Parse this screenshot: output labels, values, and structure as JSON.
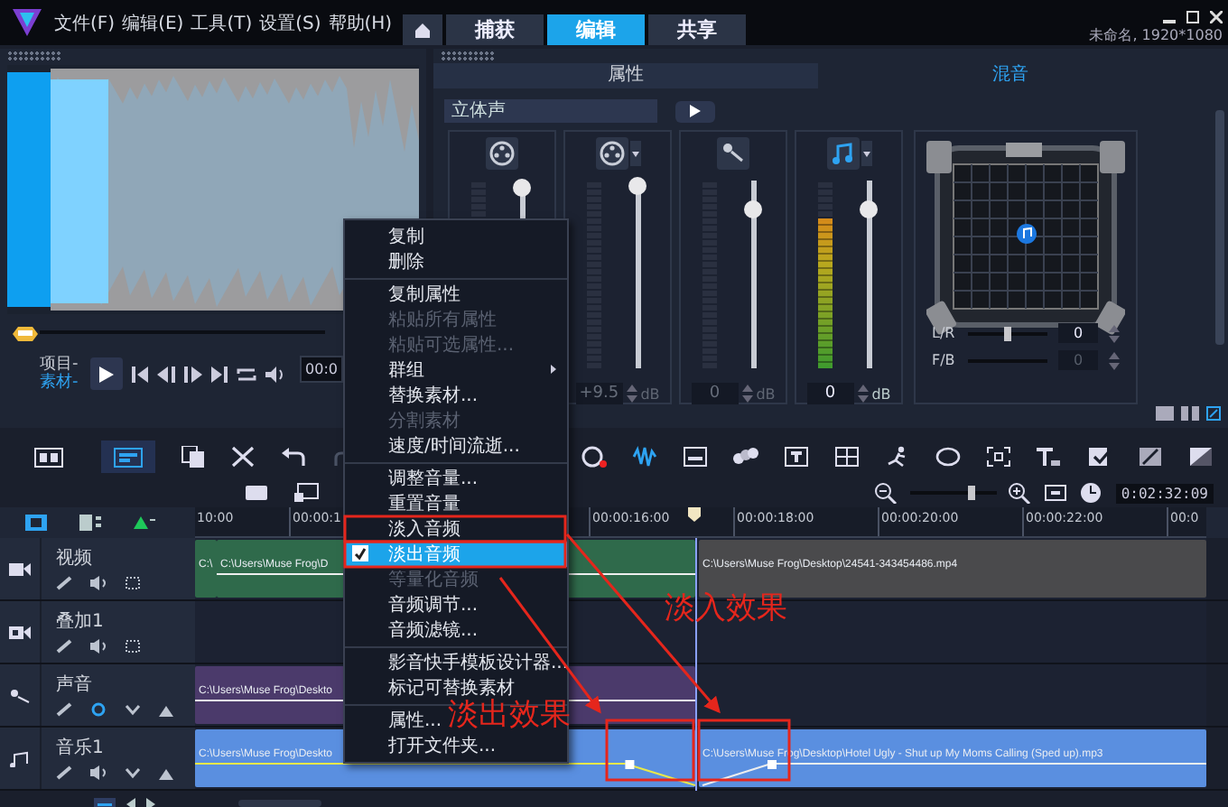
{
  "title_bar": {
    "menus": [
      "文件(F)",
      "编辑(E)",
      "工具(T)",
      "设置(S)",
      "帮助(H)"
    ],
    "tabs": [
      {
        "label": "捕获",
        "selected": false
      },
      {
        "label": "编辑",
        "selected": true
      },
      {
        "label": "共享",
        "selected": false
      }
    ],
    "project": "未命名, 1920*1080"
  },
  "preview": {
    "modes": [
      {
        "label": "项目-",
        "selected": false
      },
      {
        "label": "素材-",
        "selected": true
      }
    ],
    "timecode": "00:0"
  },
  "options": {
    "tabs": [
      {
        "label": "属性",
        "selected": false
      },
      {
        "label": "混音",
        "selected": true
      }
    ],
    "channel_mode": "立体声",
    "channels": [
      {
        "kind": "film",
        "has_menu": false,
        "slider": {
          "level": 0.96
        }
      },
      {
        "kind": "film",
        "has_menu": true,
        "slider": {
          "level": 0.97
        },
        "reading": "+9.5",
        "unit": "dB",
        "disabled": true
      },
      {
        "kind": "microphone",
        "has_menu": false,
        "slider": {
          "level": 0.85
        },
        "reading": "0",
        "unit": "dB",
        "disabled": true
      },
      {
        "kind": "music",
        "has_menu": true,
        "slider": {
          "level": 0.85
        },
        "meter": {
          "level": 0.8
        },
        "reading": "0",
        "unit": "dB",
        "disabled": false
      }
    ],
    "surround": {
      "controls": [
        {
          "label": "L/R",
          "slider": {
            "level": 0.5
          },
          "value": "0",
          "disabled": false
        },
        {
          "label": "F/B",
          "value": "0",
          "disabled": true
        }
      ]
    }
  },
  "timeline": {
    "view_modes": [
      {
        "selected": false
      },
      {
        "selected": true
      }
    ],
    "zoom": {
      "level": 0.72
    },
    "timecode": "0:02:32:09",
    "ruler": [
      "10:00",
      "00:00:1",
      "00:00:16:00",
      "00:00:18:00",
      "00:00:20:00",
      "00:00:22:00",
      "00:0"
    ],
    "tracks": [
      {
        "kind": "video",
        "name": "视频",
        "clips_before": [
          {
            "label": "C:\\",
            "color": "#2f6a4b",
            "volume_line": false
          },
          {
            "label": "C:\\Users\\Muse Frog\\D",
            "color": "#2f6a4b",
            "volume_line": true,
            "fade_in": false,
            "fade_out": false
          }
        ],
        "clips_after": [
          {
            "label": "C:\\Users\\Muse Frog\\Desktop\\24541-343454486.mp4",
            "color": "#4a4a4c",
            "volume_line": false
          }
        ]
      },
      {
        "kind": "overlay",
        "name": "叠加1"
      },
      {
        "kind": "voice",
        "name": "声音",
        "clips_before": [
          {
            "label": "C:\\Users\\Muse Frog\\Deskto",
            "color": "#4b3a6b",
            "volume_line": true,
            "fade_in": false,
            "fade_out": false
          }
        ]
      },
      {
        "kind": "music",
        "name": "音乐1",
        "clips_before": [
          {
            "label": "C:\\Users\\Muse Frog\\Deskto",
            "color": "#5a8fe0",
            "volume_line": true,
            "fade_in": false,
            "fade_out": true
          }
        ],
        "clips_after": [
          {
            "label": "C:\\Users\\Muse Frog\\Desktop\\Hotel Ugly - Shut up My Moms Calling (Sped up).mp3",
            "color": "#5a8fe0",
            "volume_line": true,
            "fade_in": true,
            "fade_out": false
          }
        ]
      }
    ]
  },
  "context_menu": {
    "items": [
      {
        "kind": "item",
        "label": "复制",
        "disabled": false,
        "checked": false,
        "selected": false
      },
      {
        "kind": "item",
        "label": "删除",
        "disabled": false,
        "checked": false,
        "selected": false
      },
      {
        "kind": "separator"
      },
      {
        "kind": "item",
        "label": "复制属性",
        "disabled": false,
        "checked": false,
        "selected": false
      },
      {
        "kind": "item",
        "label": "粘贴所有属性",
        "disabled": true,
        "checked": false,
        "selected": false
      },
      {
        "kind": "item",
        "label": "粘贴可选属性...",
        "disabled": true,
        "checked": false,
        "selected": false
      },
      {
        "kind": "submenu",
        "label": "群组",
        "disabled": false,
        "checked": false,
        "selected": false
      },
      {
        "kind": "item",
        "label": "替换素材...",
        "disabled": false,
        "checked": false,
        "selected": false
      },
      {
        "kind": "item",
        "label": "分割素材",
        "disabled": true,
        "checked": false,
        "selected": false
      },
      {
        "kind": "item",
        "label": "速度/时间流逝...",
        "disabled": false,
        "checked": false,
        "selected": false
      },
      {
        "kind": "separator"
      },
      {
        "kind": "item",
        "label": "调整音量...",
        "disabled": false,
        "checked": false,
        "selected": false
      },
      {
        "kind": "item",
        "label": "重置音量",
        "disabled": false,
        "checked": false,
        "selected": false
      },
      {
        "kind": "item",
        "label": "淡入音频",
        "disabled": false,
        "checked": false,
        "selected": false
      },
      {
        "kind": "item",
        "label": "淡出音频",
        "disabled": false,
        "checked": true,
        "selected": true
      },
      {
        "kind": "item",
        "label": "等量化音频",
        "disabled": true,
        "checked": false,
        "selected": false
      },
      {
        "kind": "item",
        "label": "音频调节...",
        "disabled": false,
        "checked": false,
        "selected": false
      },
      {
        "kind": "item",
        "label": "音频滤镜...",
        "disabled": false,
        "checked": false,
        "selected": false
      },
      {
        "kind": "separator"
      },
      {
        "kind": "item",
        "label": "影音快手模板设计器...",
        "disabled": false,
        "checked": false,
        "selected": false
      },
      {
        "kind": "item",
        "label": "标记可替换素材",
        "disabled": false,
        "checked": false,
        "selected": false
      },
      {
        "kind": "separator"
      },
      {
        "kind": "item",
        "label": "属性...",
        "disabled": false,
        "checked": false,
        "selected": false
      },
      {
        "kind": "item",
        "label": "打开文件夹...",
        "disabled": false,
        "checked": false,
        "selected": false
      }
    ]
  },
  "annotations": [
    {
      "kind": "fade_out",
      "text": "淡出效果"
    },
    {
      "kind": "fade_in",
      "text": "淡入效果"
    }
  ]
}
